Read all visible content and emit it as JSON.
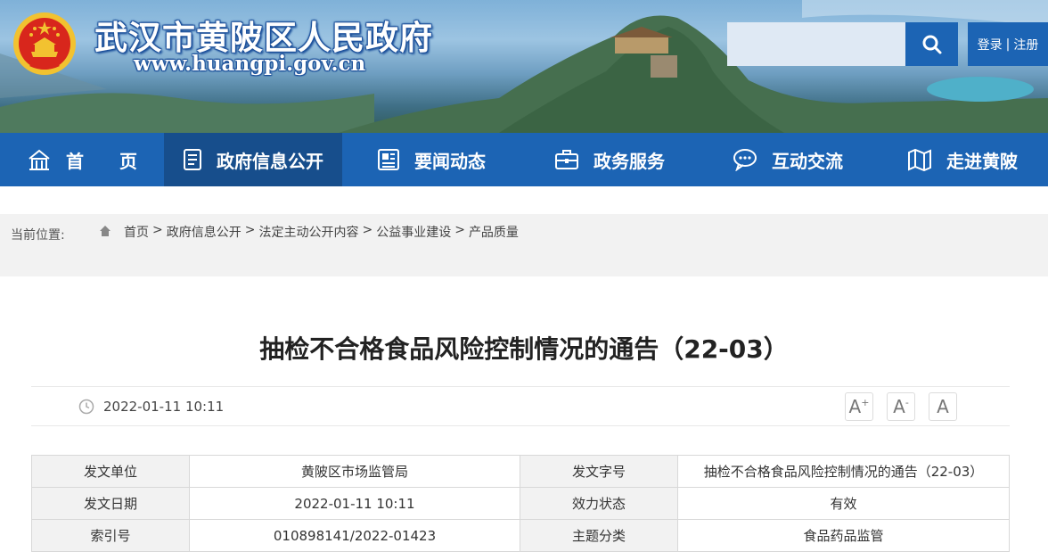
{
  "header": {
    "site_name": "武汉市黄陂区人民政府",
    "site_url": "www.huangpi.gov.cn",
    "search": {
      "placeholder": "",
      "button_icon": "search-icon"
    },
    "auth": {
      "login": "登录",
      "divider": "|",
      "register": "注册"
    }
  },
  "nav": {
    "items": [
      {
        "label": "首　　页",
        "icon": "home-icon"
      },
      {
        "label": "政府信息公开",
        "icon": "document-icon",
        "active": true
      },
      {
        "label": "要闻动态",
        "icon": "news-icon"
      },
      {
        "label": "政务服务",
        "icon": "briefcase-icon"
      },
      {
        "label": "互动交流",
        "icon": "chat-icon"
      },
      {
        "label": "走进黄陂",
        "icon": "map-icon"
      }
    ]
  },
  "breadcrumb": {
    "label": "当前位置:",
    "items": [
      "首页",
      "政府信息公开",
      "法定主动公开内容",
      "公益事业建设",
      "产品质量"
    ],
    "separator": ">"
  },
  "article": {
    "title": "抽检不合格食品风险控制情况的通告（22-03）",
    "publish_time": "2022-01-11 10:11",
    "font_buttons": {
      "larger": "A",
      "smaller": "A",
      "reset": "A",
      "plus": "+",
      "minus": "-"
    }
  },
  "info_table": {
    "rows": [
      {
        "k1": "发文单位",
        "v1": "黄陂区市场监管局",
        "k2": "发文字号",
        "v2": "抽检不合格食品风险控制情况的通告（22-03）"
      },
      {
        "k1": "发文日期",
        "v1": "2022-01-11 10:11",
        "k2": "效力状态",
        "v2": "有效"
      },
      {
        "k1": "索引号",
        "v1": "010898141/2022-01423",
        "k2": "主题分类",
        "v2": "食品药品监管"
      }
    ]
  },
  "colors": {
    "primary": "#1c64b4",
    "nav_active": "#174e8c",
    "crumb_bg": "#f2f2f2"
  }
}
